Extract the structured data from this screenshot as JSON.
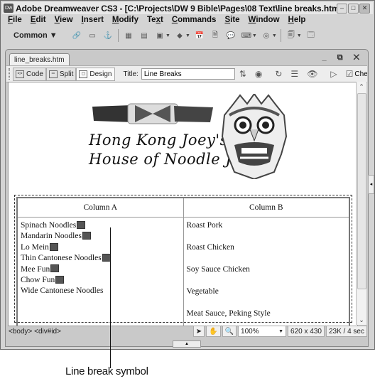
{
  "window": {
    "app_icon": "Dw",
    "title": "Adobe Dreamweaver CS3 - [C:\\Projects\\DW 9 Bible\\Pages\\08  Text\\line  breaks.htm]",
    "controls": [
      "minimize-icon",
      "maximize-icon",
      "close-icon"
    ]
  },
  "menu": [
    {
      "label": "File",
      "accel": "F"
    },
    {
      "label": "Edit",
      "accel": "E"
    },
    {
      "label": "View",
      "accel": "V"
    },
    {
      "label": "Insert",
      "accel": "I"
    },
    {
      "label": "Modify",
      "accel": "M"
    },
    {
      "label": "Text",
      "accel": "x"
    },
    {
      "label": "Commands",
      "accel": "C"
    },
    {
      "label": "Site",
      "accel": "S"
    },
    {
      "label": "Window",
      "accel": "W"
    },
    {
      "label": "Help",
      "accel": "H"
    }
  ],
  "insert_bar": {
    "category": "Common",
    "icons": [
      "hyperlink-icon",
      "email-link-icon",
      "named-anchor-icon",
      "table-icon",
      "div-icon",
      "images-icon",
      "media-icon",
      "date-icon",
      "server-include-icon",
      "comment-icon",
      "head-icon",
      "script-icon",
      "templates-icon",
      "tag-chooser-icon"
    ]
  },
  "document": {
    "tab_label": "line_breaks.htm",
    "views": {
      "code": "Code",
      "split": "Split",
      "design": "Design"
    },
    "title_label": "Title:",
    "title_value": "Line Breaks",
    "toolbar_overflow": "Che"
  },
  "page": {
    "banner_line1": "Hong Kong Joey's",
    "banner_line2": "House of Noodle Joy",
    "table": {
      "headers": [
        "Column A",
        "Column B"
      ],
      "column_a": [
        "Spinach Noodles",
        "Mandarin Noodles",
        "Lo Mein",
        "Thin Cantonese Noodles",
        "Mee Fun",
        "Chow Fun",
        "Wide Cantonese Noodles"
      ],
      "column_a_has_break": [
        true,
        true,
        true,
        true,
        true,
        true,
        false
      ],
      "column_b": [
        "Roast Pork",
        "Roast Chicken",
        "Soy Sauce Chicken",
        "Vegetable",
        "Meat Sauce, Peking Style"
      ]
    }
  },
  "status": {
    "tag_selector": "<body> <div#id>",
    "zoom": "100%",
    "dimensions": "620 x 430",
    "download": "23K / 4 sec"
  },
  "annotation": {
    "callout": "Line break symbol"
  }
}
